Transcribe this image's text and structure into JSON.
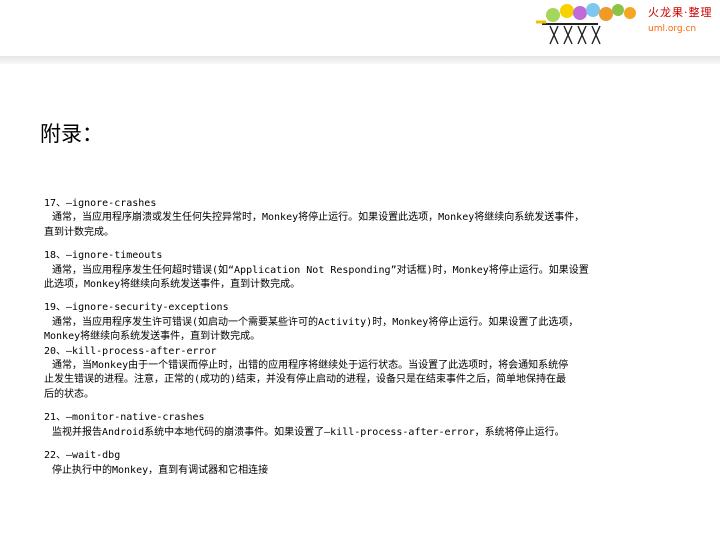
{
  "header": {
    "brand_name": "火龙果·整理",
    "brand_url": "uml.org.cn",
    "accent_color": "#cc0000"
  },
  "slide": {
    "title": "附录：",
    "entries": [
      {
        "heading": "17、—ignore-crashes",
        "lines": [
          "通常，当应用程序崩溃或发生任何失控异常时，Monkey将停止运行。如果设置此选项，Monkey将继续向系统发送事件，",
          "直到计数完成。"
        ]
      },
      {
        "heading": "18、—ignore-timeouts",
        "lines": [
          "通常，当应用程序发生任何超时错误(如“Application Not Responding”对话框)时，Monkey将停止运行。如果设置",
          "此选项，Monkey将继续向系统发送事件，直到计数完成。"
        ]
      },
      {
        "heading": "19、—ignore-security-exceptions",
        "lines": [
          "通常，当应用程序发生许可错误(如启动一个需要某些许可的Activity)时，Monkey将停止运行。如果设置了此选项，",
          "Monkey将继续向系统发送事件，直到计数完成。"
        ]
      },
      {
        "heading": "20、—kill-process-after-error",
        "lines": [
          "通常，当Monkey由于一个错误而停止时，出错的应用程序将继续处于运行状态。当设置了此选项时，将会通知系统停",
          "止发生错误的进程。注意，正常的(成功的)结束，并没有停止启动的进程，设备只是在结束事件之后，简单地保持在最",
          "后的状态。"
        ]
      },
      {
        "heading": "21、—monitor-native-crashes",
        "lines": [
          "监视并报告Android系统中本地代码的崩溃事件。如果设置了—kill-process-after-error，系统将停止运行。"
        ]
      },
      {
        "heading": "22、—wait-dbg",
        "lines": [
          "停止执行中的Monkey，直到有调试器和它相连接"
        ]
      }
    ]
  }
}
